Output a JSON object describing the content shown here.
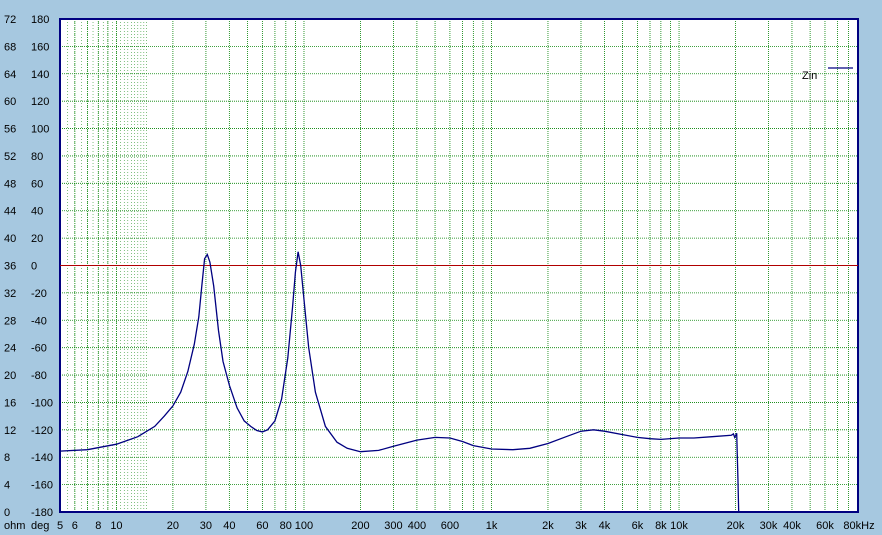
{
  "chart_data": {
    "type": "line",
    "title": "",
    "x_scale": "log",
    "xlim": [
      5,
      90000
    ],
    "grid": true,
    "legend_placement": "top-right",
    "colors": {
      "background": "#a6c8e0",
      "plot_bg": "#ffffff",
      "frame": "#000080",
      "grid": "#008000",
      "series": "#000080",
      "reference_line": "#b00000"
    },
    "x_ticks": [
      {
        "value": 5,
        "label": "5"
      },
      {
        "value": 6,
        "label": "6"
      },
      {
        "value": 8,
        "label": "8"
      },
      {
        "value": 10,
        "label": "10"
      },
      {
        "value": 20,
        "label": "20"
      },
      {
        "value": 30,
        "label": "30"
      },
      {
        "value": 40,
        "label": "40"
      },
      {
        "value": 60,
        "label": "60"
      },
      {
        "value": 80,
        "label": "80"
      },
      {
        "value": 100,
        "label": "100"
      },
      {
        "value": 200,
        "label": "200"
      },
      {
        "value": 300,
        "label": "300"
      },
      {
        "value": 400,
        "label": "400"
      },
      {
        "value": 600,
        "label": "600"
      },
      {
        "value": 1000,
        "label": "1k"
      },
      {
        "value": 2000,
        "label": "2k"
      },
      {
        "value": 3000,
        "label": "3k"
      },
      {
        "value": 4000,
        "label": "4k"
      },
      {
        "value": 6000,
        "label": "6k"
      },
      {
        "value": 8000,
        "label": "8k"
      },
      {
        "value": 10000,
        "label": "10k"
      },
      {
        "value": 20000,
        "label": "20k"
      },
      {
        "value": 30000,
        "label": "30k"
      },
      {
        "value": 40000,
        "label": "40k"
      },
      {
        "value": 60000,
        "label": "60k"
      },
      {
        "value": 80000,
        "label": "80kHz"
      }
    ],
    "y_left": {
      "label": "ohm",
      "ylim": [
        0,
        72
      ],
      "ticks": [
        "72",
        "68",
        "64",
        "60",
        "56",
        "52",
        "48",
        "44",
        "40",
        "36",
        "32",
        "28",
        "24",
        "20",
        "16",
        "12",
        "8",
        "4",
        "0"
      ]
    },
    "y_right": {
      "label": "deg",
      "ylim": [
        -180,
        180
      ],
      "ticks": [
        "180",
        "160",
        "140",
        "120",
        "100",
        "80",
        "60",
        "40",
        "20",
        "0",
        "-20",
        "-40",
        "-60",
        "-80",
        "-100",
        "-120",
        "-140",
        "-160",
        "-180"
      ]
    },
    "reference_lines": [
      {
        "axis": "deg",
        "value": 0
      }
    ],
    "series": [
      {
        "name": "Zin",
        "axis": "ohm",
        "points": [
          [
            5,
            8.9
          ],
          [
            7,
            9.1
          ],
          [
            10,
            9.9
          ],
          [
            13,
            11.0
          ],
          [
            16,
            12.5
          ],
          [
            18,
            14.0
          ],
          [
            20,
            15.5
          ],
          [
            22,
            17.5
          ],
          [
            24,
            20.5
          ],
          [
            26,
            24.5
          ],
          [
            27.5,
            28.5
          ],
          [
            28.5,
            33.0
          ],
          [
            29.5,
            37.0
          ],
          [
            30.5,
            37.6
          ],
          [
            31.5,
            36.5
          ],
          [
            33,
            33.0
          ],
          [
            35,
            26.5
          ],
          [
            37,
            22.0
          ],
          [
            40,
            18.5
          ],
          [
            44,
            15.2
          ],
          [
            48,
            13.3
          ],
          [
            52,
            12.5
          ],
          [
            56,
            11.9
          ],
          [
            60,
            11.7
          ],
          [
            64,
            12.0
          ],
          [
            70,
            13.3
          ],
          [
            76,
            16.5
          ],
          [
            82,
            22.5
          ],
          [
            87,
            30.0
          ],
          [
            90,
            35.0
          ],
          [
            93,
            38.0
          ],
          [
            96,
            36.0
          ],
          [
            100,
            31.0
          ],
          [
            106,
            24.0
          ],
          [
            115,
            17.5
          ],
          [
            130,
            12.5
          ],
          [
            150,
            10.2
          ],
          [
            170,
            9.3
          ],
          [
            200,
            8.8
          ],
          [
            250,
            9.0
          ],
          [
            300,
            9.6
          ],
          [
            400,
            10.5
          ],
          [
            500,
            10.9
          ],
          [
            600,
            10.8
          ],
          [
            700,
            10.3
          ],
          [
            800,
            9.7
          ],
          [
            1000,
            9.2
          ],
          [
            1300,
            9.1
          ],
          [
            1600,
            9.3
          ],
          [
            2000,
            10.0
          ],
          [
            2500,
            11.0
          ],
          [
            3000,
            11.8
          ],
          [
            3500,
            12.0
          ],
          [
            4000,
            11.8
          ],
          [
            5000,
            11.3
          ],
          [
            6000,
            10.9
          ],
          [
            7000,
            10.7
          ],
          [
            8000,
            10.6
          ],
          [
            10000,
            10.8
          ],
          [
            12000,
            10.8
          ],
          [
            15000,
            11.0
          ],
          [
            19000,
            11.2
          ],
          [
            19500,
            11.4
          ],
          [
            19800,
            10.9
          ],
          [
            20300,
            11.5
          ],
          [
            20600,
            5.0
          ],
          [
            20800,
            0
          ]
        ]
      }
    ]
  }
}
